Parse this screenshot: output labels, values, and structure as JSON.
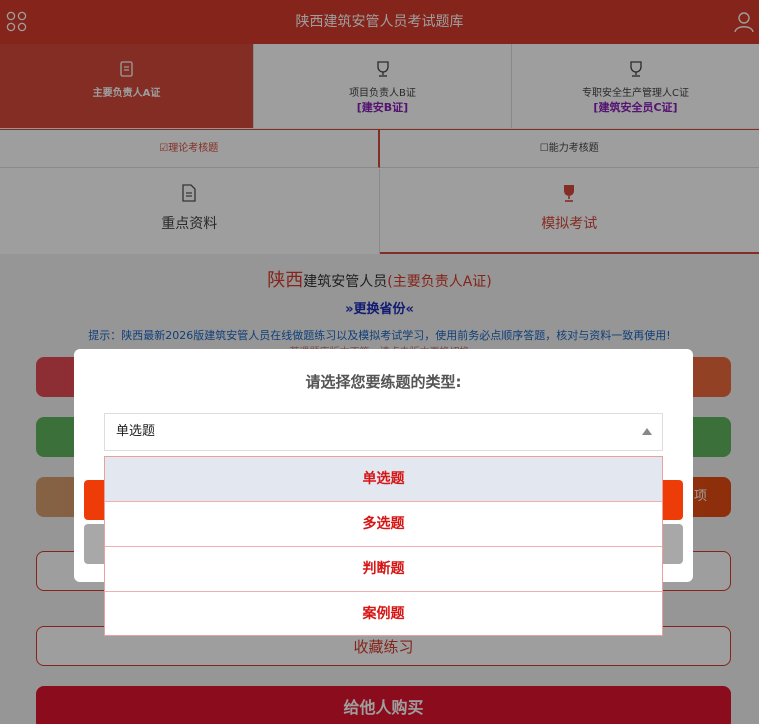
{
  "header": {
    "title": "陕西建筑安管人员考试题库"
  },
  "cert_tabs": [
    {
      "label": "主要负责人A证",
      "sub": ""
    },
    {
      "label": "项目负责人B证",
      "sub": "[建安B证]"
    },
    {
      "label": "专职安全生产管理人C证",
      "sub": "[建筑安全员C证]"
    }
  ],
  "exam_tabs": [
    {
      "label": "☑理论考核题"
    },
    {
      "label": "☐能力考核题"
    }
  ],
  "feature_tabs": [
    {
      "label": "重点资料"
    },
    {
      "label": "模拟考试"
    }
  ],
  "region": {
    "province": "陕西",
    "middle": "建筑安管人员",
    "role": "(主要负责人A证)",
    "switch_label": "»更换省份«"
  },
  "notice": {
    "text": "提示：陕西最新2026版建筑安管人员在线做题练习以及模拟考试学习，使用前务必点顺序答题，核对与资料一致再使用!",
    "text2": "若遇题库版本不符，请点击版本更换切换"
  },
  "buttons": {
    "side_label": "项",
    "favorite_label": "收藏练习",
    "buy_label": "给他人购买"
  },
  "colors": {
    "brand_red": "#d63b2a",
    "button_red": "#e44a55",
    "button_orange_right": "#ee6a3a",
    "button_green": "#5fb55f",
    "button_tan": "#d9a070",
    "button_orange": "#e54a10"
  },
  "modal": {
    "title": "请选择您要练题的类型:",
    "selected_value": "单选题",
    "options": [
      "单选题",
      "多选题",
      "判断题",
      "案例题"
    ]
  }
}
